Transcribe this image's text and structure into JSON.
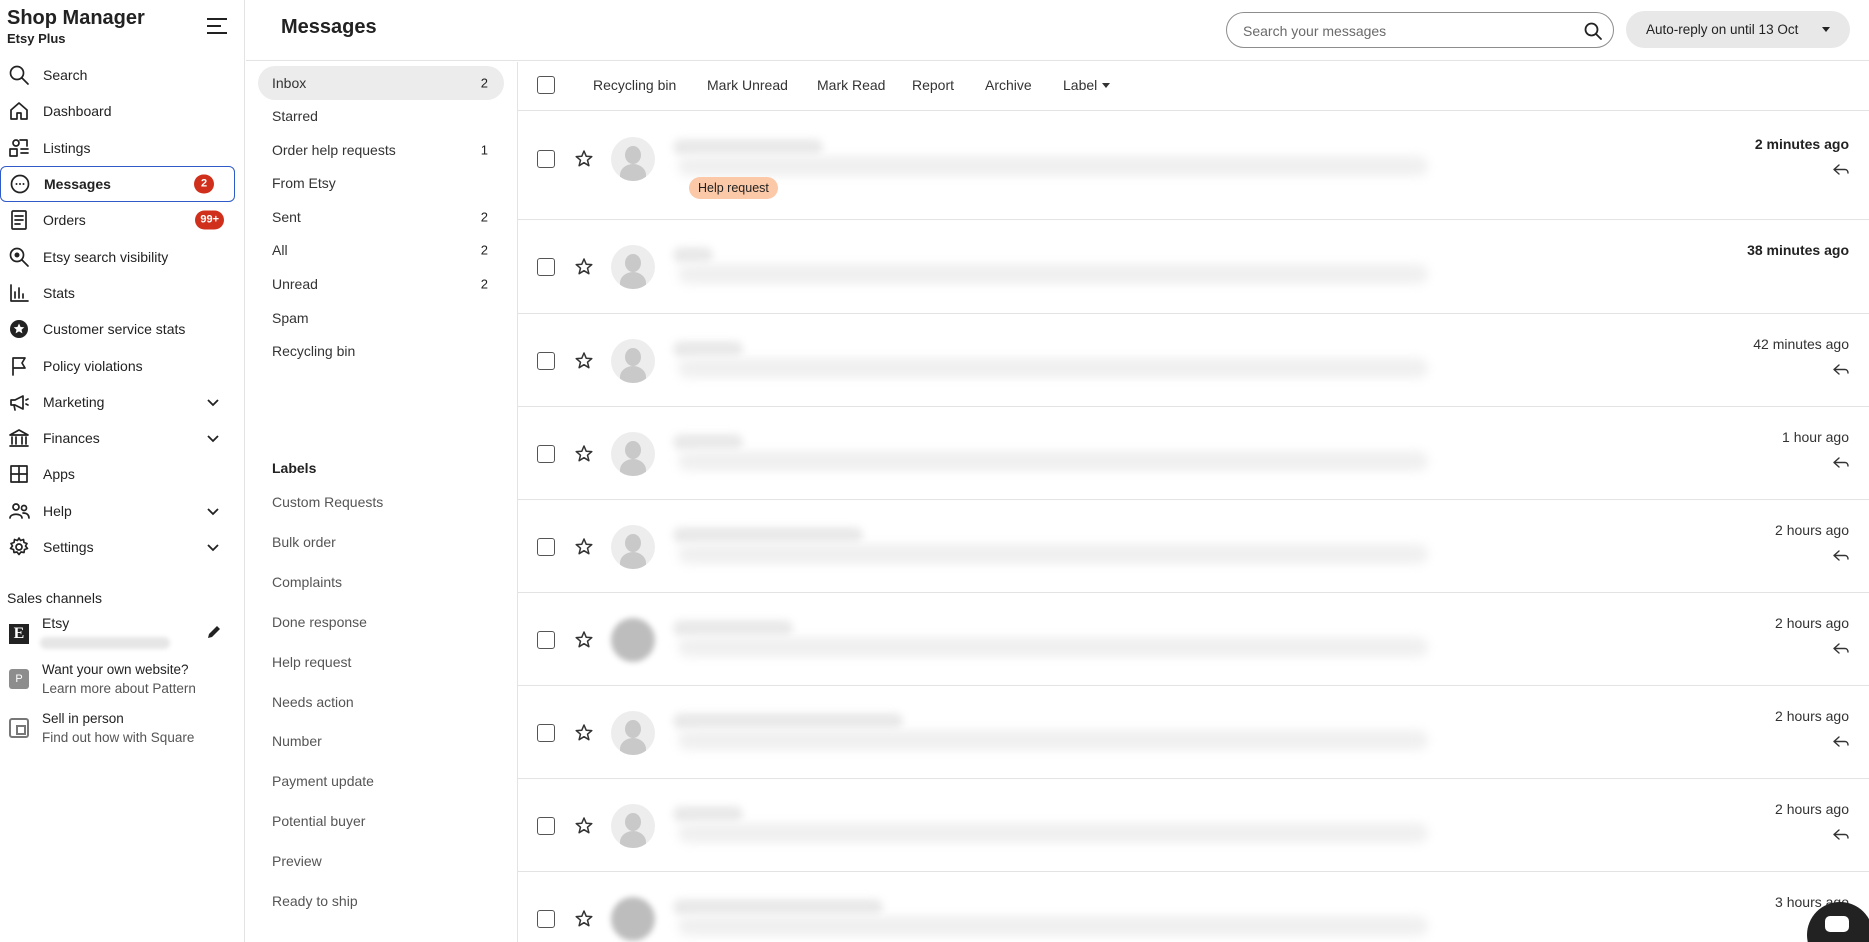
{
  "nav": {
    "app_title": "Shop Manager",
    "plan": "Etsy Plus",
    "items": [
      {
        "label": "Search",
        "icon": "search-icon"
      },
      {
        "label": "Dashboard",
        "icon": "home-icon"
      },
      {
        "label": "Listings",
        "icon": "listings-icon"
      },
      {
        "label": "Messages",
        "icon": "chat-icon",
        "badge": "2",
        "active": true
      },
      {
        "label": "Orders",
        "icon": "receipt-icon",
        "badge": "99+"
      },
      {
        "label": "Etsy search visibility",
        "icon": "search-visibility-icon"
      },
      {
        "label": "Stats",
        "icon": "bar-chart-icon"
      },
      {
        "label": "Customer service stats",
        "icon": "star-badge-icon"
      },
      {
        "label": "Policy violations",
        "icon": "flag-icon"
      },
      {
        "label": "Marketing",
        "icon": "megaphone-icon",
        "expandable": true
      },
      {
        "label": "Finances",
        "icon": "bank-icon",
        "expandable": true
      },
      {
        "label": "Apps",
        "icon": "grid-icon"
      },
      {
        "label": "Help",
        "icon": "people-icon",
        "expandable": true
      },
      {
        "label": "Settings",
        "icon": "gear-icon",
        "expandable": true
      }
    ],
    "sales_channels_heading": "Sales channels",
    "etsy_channel": {
      "name": "Etsy",
      "icon_letter": "E"
    },
    "pattern_promo": {
      "title": "Want your own website?",
      "subtitle": "Learn more about Pattern",
      "icon_letter": "P"
    },
    "square_promo": {
      "title": "Sell in person",
      "subtitle": "Find out how with Square"
    }
  },
  "header": {
    "title": "Messages",
    "search_placeholder": "Search your messages",
    "auto_reply_label": "Auto-reply on until 13 Oct"
  },
  "folders": [
    {
      "label": "Inbox",
      "count": "2",
      "active": true
    },
    {
      "label": "Starred",
      "count": ""
    },
    {
      "label": "Order help requests",
      "count": "1"
    },
    {
      "label": "From Etsy",
      "count": ""
    },
    {
      "label": "Sent",
      "count": "2"
    },
    {
      "label": "All",
      "count": "2"
    },
    {
      "label": "Unread",
      "count": "2"
    },
    {
      "label": "Spam",
      "count": ""
    },
    {
      "label": "Recycling bin",
      "count": ""
    }
  ],
  "labels_heading": "Labels",
  "labels": [
    "Custom Requests",
    "Bulk order",
    "Complaints",
    "Done response",
    "Help request",
    "Needs action",
    "Number",
    "Payment update",
    "Potential buyer",
    "Preview",
    "Ready to ship"
  ],
  "toolbar": {
    "recycling_bin": "Recycling bin",
    "mark_unread": "Mark Unread",
    "mark_read": "Mark Read",
    "report": "Report",
    "archive": "Archive",
    "label": "Label"
  },
  "messages": [
    {
      "time": "2 minutes ago",
      "unread": true,
      "replied": true,
      "tag": "Help request"
    },
    {
      "time": "38 minutes ago",
      "unread": true,
      "replied": false
    },
    {
      "time": "42 minutes ago",
      "unread": false,
      "replied": true
    },
    {
      "time": "1 hour ago",
      "unread": false,
      "replied": true
    },
    {
      "time": "2 hours ago",
      "unread": false,
      "replied": true
    },
    {
      "time": "2 hours ago",
      "unread": false,
      "replied": true
    },
    {
      "time": "2 hours ago",
      "unread": false,
      "replied": true
    },
    {
      "time": "2 hours ago",
      "unread": false,
      "replied": true
    },
    {
      "time": "3 hours ago",
      "unread": false,
      "replied": false
    }
  ],
  "colors": {
    "accent": "#2f5bc8",
    "badge": "#d0301b",
    "help_tag": "#fbc9a8"
  }
}
